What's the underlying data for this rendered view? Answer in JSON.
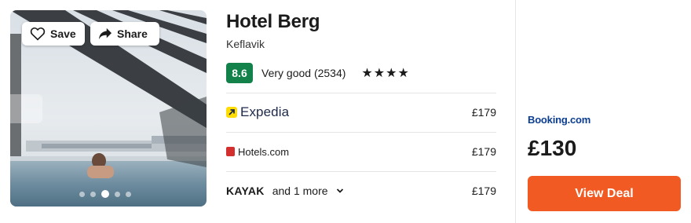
{
  "photo": {
    "save_label": "Save",
    "share_label": "Share",
    "carousel_dots": 5,
    "active_dot_index": 2
  },
  "hotel": {
    "name": "Hotel Berg",
    "location": "Keflavik",
    "score": "8.6",
    "rating_text": "Very good (2534)",
    "stars": "★★★★",
    "score_color": "#13824a"
  },
  "providers": [
    {
      "name": "Expedia",
      "price": "£179",
      "icon": "expedia-arrow-icon"
    },
    {
      "name": "Hotels.com",
      "price": "£179",
      "icon": "hotels-com-icon"
    },
    {
      "name": "KAYAK",
      "more": "and 1 more",
      "price": "£179",
      "icon": "chevron-down-icon"
    }
  ],
  "deal": {
    "provider": "Booking.com",
    "price": "£130",
    "button_label": "View Deal",
    "button_color": "#f15a22"
  }
}
